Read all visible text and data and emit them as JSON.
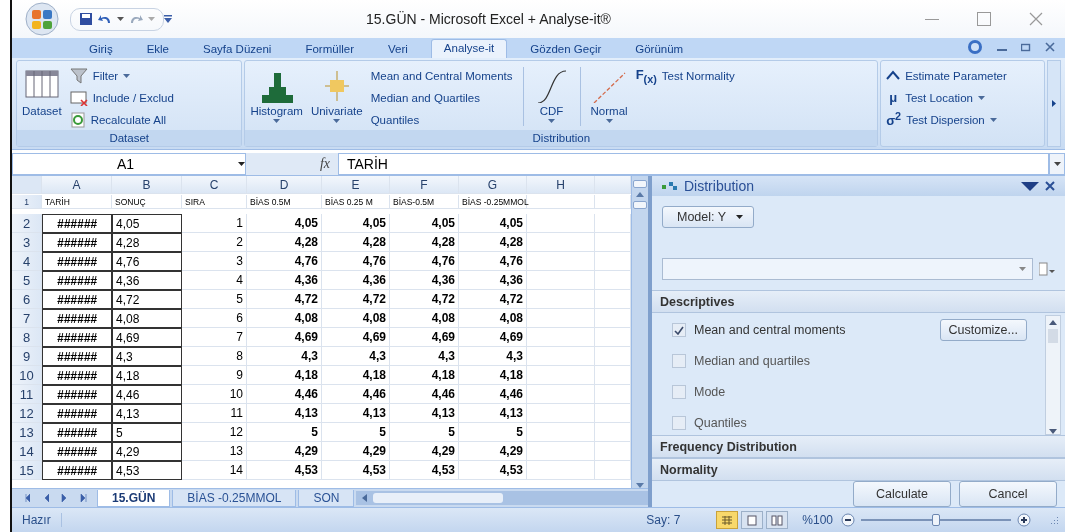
{
  "window": {
    "title": "15.GÜN - Microsoft Excel + Analyse-it®"
  },
  "ribbon_tabs": [
    {
      "label": "Giriş",
      "selected": false
    },
    {
      "label": "Ekle",
      "selected": false
    },
    {
      "label": "Sayfa Düzeni",
      "selected": false
    },
    {
      "label": "Formüller",
      "selected": false
    },
    {
      "label": "Veri",
      "selected": false
    },
    {
      "label": "Analyse-it",
      "selected": true
    },
    {
      "label": "Gözden Geçir",
      "selected": false
    },
    {
      "label": "Görünüm",
      "selected": false
    }
  ],
  "ribbon_groups": [
    {
      "label": "Dataset",
      "controls": [
        {
          "kind": "large",
          "label": "Dataset",
          "dropdown": false
        },
        {
          "kind": "stack",
          "items": [
            {
              "kind": "icon",
              "label": "Filter",
              "dropdown": true
            },
            {
              "kind": "icon",
              "label": "Include / Exclud",
              "dropdown": false
            },
            {
              "kind": "icon",
              "label": "Recalculate All",
              "dropdown": false
            }
          ]
        }
      ]
    },
    {
      "label": "Distribution",
      "controls": [
        {
          "kind": "large",
          "label": "Histogram",
          "dropdown": true
        },
        {
          "kind": "large",
          "label": "Univariate",
          "dropdown": true
        },
        {
          "kind": "stack",
          "items": [
            {
              "kind": "plain",
              "label": "Mean and Central Moments",
              "dropdown": false
            },
            {
              "kind": "plain",
              "label": "Median and Quartiles",
              "dropdown": false
            },
            {
              "kind": "plain",
              "label": "Quantiles",
              "dropdown": false
            }
          ]
        },
        {
          "kind": "separator"
        },
        {
          "kind": "large",
          "label": "CDF",
          "dropdown": true
        },
        {
          "kind": "separator"
        },
        {
          "kind": "large",
          "label": "Normal",
          "dropdown": true
        },
        {
          "kind": "stack",
          "items": [
            {
              "kind": "symbol",
              "symbol": "F$_{(x)}$",
              "label": "Test Normality",
              "dropdown": false
            }
          ]
        }
      ]
    },
    {
      "controls": [
        {
          "kind": "stack",
          "items": [
            {
              "kind": "icon",
              "label": "Estimate Parameter",
              "dropdown": false
            },
            {
              "kind": "symbol",
              "symbol": "μ",
              "label": "Test Location",
              "dropdown": true
            },
            {
              "kind": "symbol",
              "symbol": "σ$^{2}$",
              "label": "Test Dispersion",
              "dropdown": true
            }
          ]
        }
      ]
    }
  ],
  "formula_bar": {
    "name_box": "A1",
    "function_label": "fx",
    "value": "TARİH"
  },
  "sheet": {
    "columns": [
      "A",
      "B",
      "C",
      "D",
      "E",
      "F",
      "G",
      "H"
    ],
    "rows": [
      {
        "number": "1",
        "cells": [
          "TARİH",
          "SONUÇ",
          "SIRA",
          "BİAS 0.5M",
          "BİAS 0.25 M",
          "BİAS-0.5M",
          "BİAS -0.25MMOL"
        ]
      },
      {
        "number": "2",
        "cells": [
          "######",
          "4,05",
          "1",
          "4,05",
          "4,05",
          "4,05",
          "4,05"
        ]
      },
      {
        "number": "3",
        "cells": [
          "######",
          "4,28",
          "2",
          "4,28",
          "4,28",
          "4,28",
          "4,28"
        ]
      },
      {
        "number": "4",
        "cells": [
          "######",
          "4,76",
          "3",
          "4,76",
          "4,76",
          "4,76",
          "4,76"
        ]
      },
      {
        "number": "5",
        "cells": [
          "######",
          "4,36",
          "4",
          "4,36",
          "4,36",
          "4,36",
          "4,36"
        ]
      },
      {
        "number": "6",
        "cells": [
          "######",
          "4,72",
          "5",
          "4,72",
          "4,72",
          "4,72",
          "4,72"
        ]
      },
      {
        "number": "7",
        "cells": [
          "######",
          "4,08",
          "6",
          "4,08",
          "4,08",
          "4,08",
          "4,08"
        ]
      },
      {
        "number": "8",
        "cells": [
          "######",
          "4,69",
          "7",
          "4,69",
          "4,69",
          "4,69",
          "4,69"
        ]
      },
      {
        "number": "9",
        "cells": [
          "######",
          "4,3",
          "8",
          "4,3",
          "4,3",
          "4,3",
          "4,3"
        ]
      },
      {
        "number": "10",
        "cells": [
          "######",
          "4,18",
          "9",
          "4,18",
          "4,18",
          "4,18",
          "4,18"
        ]
      },
      {
        "number": "11",
        "cells": [
          "######",
          "4,46",
          "10",
          "4,46",
          "4,46",
          "4,46",
          "4,46"
        ]
      },
      {
        "number": "12",
        "cells": [
          "######",
          "4,13",
          "11",
          "4,13",
          "4,13",
          "4,13",
          "4,13"
        ]
      },
      {
        "number": "13",
        "cells": [
          "######",
          "5",
          "12",
          "5",
          "5",
          "5",
          "5"
        ]
      },
      {
        "number": "14",
        "cells": [
          "######",
          "4,29",
          "13",
          "4,29",
          "4,29",
          "4,29",
          "4,29"
        ]
      },
      {
        "number": "15",
        "cells": [
          "######",
          "4,53",
          "14",
          "4,53",
          "4,53",
          "4,53",
          "4,53"
        ]
      }
    ],
    "sheet_tabs": [
      {
        "label": "15.GÜN",
        "selected": true
      },
      {
        "label": "BİAS -0.25MMOL",
        "selected": false
      },
      {
        "label": "SON",
        "selected": false
      }
    ]
  },
  "task_pane": {
    "title": "Distribution",
    "model_button": "Model: Y",
    "sections": [
      {
        "title": "Descriptives",
        "expanded": true,
        "options": [
          {
            "label": "Mean and central moments",
            "checked": true,
            "button": "Customize..."
          },
          {
            "label": "Median and quartiles",
            "checked": false
          },
          {
            "label": "Mode",
            "checked": false
          },
          {
            "label": "Quantiles",
            "checked": false
          }
        ]
      },
      {
        "title": "Frequency Distribution",
        "expanded": false
      },
      {
        "title": "Normality",
        "expanded": false
      }
    ],
    "buttons": [
      "Calculate",
      "Cancel"
    ]
  },
  "status_bar": {
    "status": "Hazır",
    "count": "Say: 7",
    "views": [
      {
        "selected": true
      },
      {
        "selected": false
      },
      {
        "selected": false
      }
    ],
    "zoom": "%100",
    "zoom_slider": {
      "level": 0.5
    }
  }
}
